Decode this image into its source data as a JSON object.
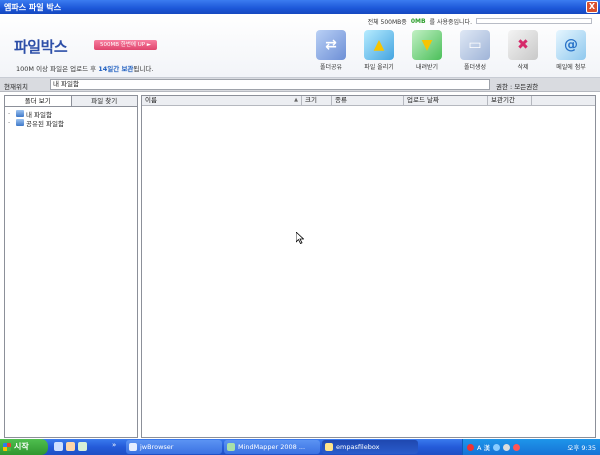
{
  "window": {
    "title": "엠파스 파일 박스",
    "close_label": "X"
  },
  "usage": {
    "prefix": "전체 500MB중",
    "used": "0MB",
    "suffix": "를 사용중입니다."
  },
  "brand": {
    "logo": "파일박스",
    "promo": "500MB 한번에 UP ►"
  },
  "notice": {
    "part1": "100M 이상 파일은 업로드 후",
    "days": "14일간 보관",
    "part2": "됩니다."
  },
  "toolbar": [
    {
      "label": "폴더공유",
      "icon": "folder-share-icon"
    },
    {
      "label": "파일 올리기",
      "icon": "upload-icon"
    },
    {
      "label": "내려받기",
      "icon": "download-icon"
    },
    {
      "label": "폴더생성",
      "icon": "new-folder-icon"
    },
    {
      "label": "삭제",
      "icon": "delete-icon"
    },
    {
      "label": "메일에 첨부",
      "icon": "email-attach-icon"
    }
  ],
  "location": {
    "label": "현재위치",
    "value": "내 파일함",
    "permission": "권한 : 모든권한"
  },
  "left_tabs": {
    "folder_view": "폴더 보기",
    "file_search": "파일 찾기"
  },
  "tree": [
    {
      "label": "내 파일함"
    },
    {
      "label": "공유된 파일함"
    }
  ],
  "columns": [
    "이름",
    "크기",
    "종류",
    "업로드 날짜",
    "보관기간"
  ],
  "taskbar": {
    "start": "시작",
    "tasks": [
      "jwBrowser",
      "MindMapper 2008 ...",
      "empasfilebox"
    ],
    "tray_text": "A 漢",
    "clock": "오후 9:35"
  }
}
